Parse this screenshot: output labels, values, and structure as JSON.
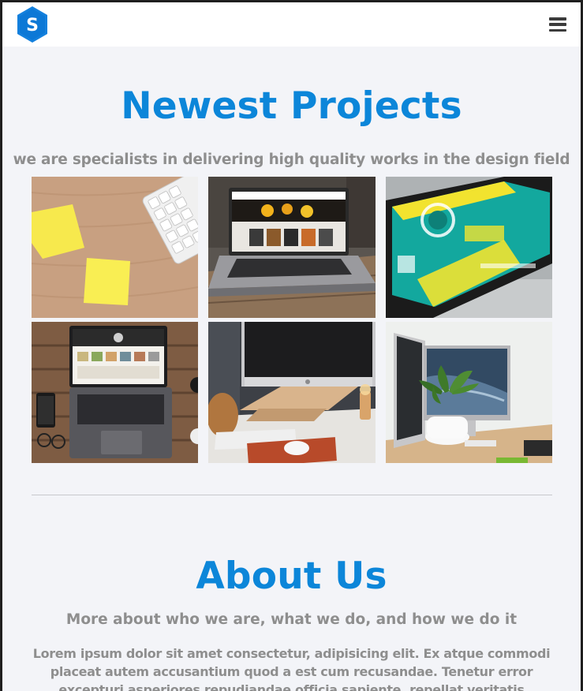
{
  "navbar": {
    "logo_letter": "S",
    "menu_icon": "hamburger-menu-icon"
  },
  "projects": {
    "title": "Newest Projects",
    "subtitle": "we are specialists in delivering high quality works in the design field",
    "items": [
      {
        "image": "sticky-notes-keyboard-desk"
      },
      {
        "image": "laptop-on-wooden-table"
      },
      {
        "image": "smartphone-billing-app"
      },
      {
        "image": "laptop-top-view-desk"
      },
      {
        "image": "imac-workspace-desk"
      },
      {
        "image": "imac-with-plant"
      }
    ]
  },
  "about": {
    "title": "About Us",
    "subtitle": "More about who we are, what we do, and how we do it",
    "text": "Lorem ipsum dolor sit amet consectetur, adipisicing elit. Ex atque commodi placeat autem accusantium quod a est cum recusandae. Tenetur error excepturi asperiores repudiandae officia sapiente, repellat veritatis voluptatibus"
  },
  "colors": {
    "accent": "#0c86d9",
    "muted_text": "#8e8e8e",
    "background": "#f3f4f8"
  }
}
